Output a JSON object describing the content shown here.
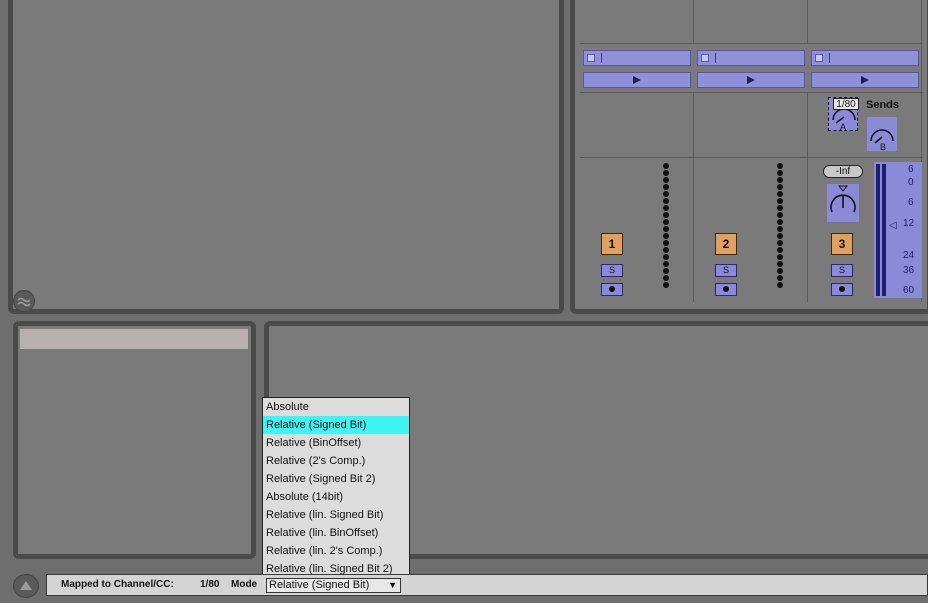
{
  "tracks": [
    {
      "number": "1",
      "solo": "S"
    },
    {
      "number": "2",
      "solo": "S"
    },
    {
      "number": "3",
      "solo": "S"
    }
  ],
  "sends": {
    "label": "Sends",
    "mapping_badge": "1/80",
    "knob_a": "A",
    "knob_b": "B"
  },
  "volume": {
    "readout": "-Inf",
    "scale": [
      "6",
      "0",
      "6",
      "12",
      "24",
      "36",
      "60"
    ]
  },
  "mode_menu": {
    "selected_index": 1,
    "options": [
      "Absolute",
      "Relative (Signed Bit)",
      "Relative (BinOffset)",
      "Relative (2's Comp.)",
      "Relative (Signed Bit 2)",
      "Absolute (14bit)",
      "Relative (lin. Signed Bit)",
      "Relative (lin. BinOffset)",
      "Relative (lin. 2's Comp.)",
      "Relative (lin. Signed Bit 2)"
    ]
  },
  "status_bar": {
    "mapped_label": "Mapped to Channel/CC:",
    "mapped_value": "1/80",
    "mode_label": "Mode",
    "mode_value": "Relative (Signed Bit)",
    "dropdown_arrow": "▼"
  },
  "colors": {
    "clip_blue": "#9090d8",
    "track_orange": "#e0a060",
    "highlight_cyan": "#40f4f4"
  }
}
